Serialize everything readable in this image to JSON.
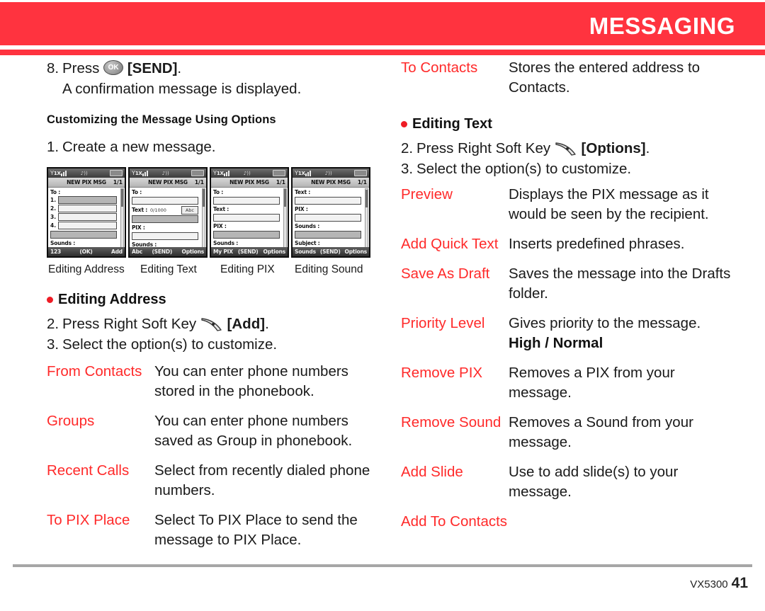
{
  "header": {
    "title": "MESSAGING",
    "band_color": "#ff333f"
  },
  "accent": {
    "red": "#ff2a2a",
    "bullet": "#ee1c25"
  },
  "left": {
    "step8": {
      "num": "8.",
      "press": "Press",
      "key_label": "OK",
      "bracket": "[SEND]",
      "tail": "."
    },
    "step8_sub": "A confirmation message is displayed.",
    "section_heading": "Customizing the Message Using Options",
    "step1": {
      "num": "1.",
      "text": "Create a new message."
    },
    "shots": [
      {
        "caption": "Editing Address",
        "title": "NEW PIX MSG",
        "page": "1/1",
        "fields": [
          "To :"
        ],
        "numbered": [
          "1.",
          "2.",
          "3.",
          "4."
        ],
        "bottom_field": "Sounds :",
        "soft_left": "123",
        "soft_center": "(OK)",
        "soft_right": "Add"
      },
      {
        "caption": "Editing Text",
        "title": "NEW PIX MSG",
        "page": "1/1",
        "fields": [
          "To :",
          "Text :",
          "PIX :"
        ],
        "counter": "0/1000",
        "mode": "Abc",
        "bottom_field": "Sounds :",
        "soft_left": "Abc",
        "soft_center": "(SEND)",
        "soft_right": "Options"
      },
      {
        "caption": "Editing PIX",
        "title": "NEW PIX MSG",
        "page": "1/1",
        "fields": [
          "To :",
          "Text :",
          "PIX :"
        ],
        "bottom_field": "Sounds :",
        "soft_left": "My PIX",
        "soft_center": "(SEND)",
        "soft_right": "Options"
      },
      {
        "caption": "Editing Sound",
        "title": "NEW PIX MSG",
        "page": "1/1",
        "fields": [
          "Text :",
          "PIX :",
          "Sounds :"
        ],
        "bottom_field": "Subject :",
        "soft_left": "Sounds",
        "soft_center": "(SEND)",
        "soft_right": "Options"
      }
    ],
    "editing_address": {
      "bullet_title": "Editing Address",
      "step2": {
        "num": "2.",
        "text": "Press Right Soft Key",
        "bracket": "[Add]",
        "tail": "."
      },
      "step3": {
        "num": "3.",
        "text": "Select the option(s) to customize."
      },
      "options": [
        {
          "term": "From Contacts",
          "desc": "You can enter phone numbers stored in the phonebook."
        },
        {
          "term": "Groups",
          "desc": "You can enter phone numbers saved as Group in phonebook."
        },
        {
          "term": "Recent Calls",
          "desc": "Select from recently dialed phone numbers."
        },
        {
          "term": "To PIX Place",
          "desc": "Select To PIX Place to send the message to PIX Place."
        }
      ]
    }
  },
  "right": {
    "continued_option": {
      "term": "To Contacts",
      "desc": "Stores the entered address to Contacts."
    },
    "editing_text": {
      "bullet_title": "Editing Text",
      "step2": {
        "num": "2.",
        "text": "Press Right Soft Key",
        "bracket": "[Options]",
        "tail": "."
      },
      "step3": {
        "num": "3.",
        "text": "Select the option(s) to customize."
      },
      "options": [
        {
          "term": "Preview",
          "desc": "Displays the PIX message as it would be seen by the recipient.",
          "extra": ""
        },
        {
          "term": "Add Quick Text",
          "desc": "Inserts predefined phrases.",
          "extra": ""
        },
        {
          "term": "Save As Draft",
          "desc": "Saves the message into the Drafts folder.",
          "extra": ""
        },
        {
          "term": "Priority Level",
          "desc": "Gives priority to the message.",
          "extra": "High / Normal"
        },
        {
          "term": "Remove PIX",
          "desc": "Removes a PIX from your message.",
          "extra": ""
        },
        {
          "term": "Remove Sound",
          "desc": "Removes a Sound from your message.",
          "extra": ""
        },
        {
          "term": "Add Slide",
          "desc": "Use to add slide(s) to your message.",
          "extra": ""
        },
        {
          "term": "Add To Contacts",
          "desc": "",
          "extra": ""
        }
      ]
    }
  },
  "footer": {
    "model": "VX5300",
    "page": "41"
  }
}
